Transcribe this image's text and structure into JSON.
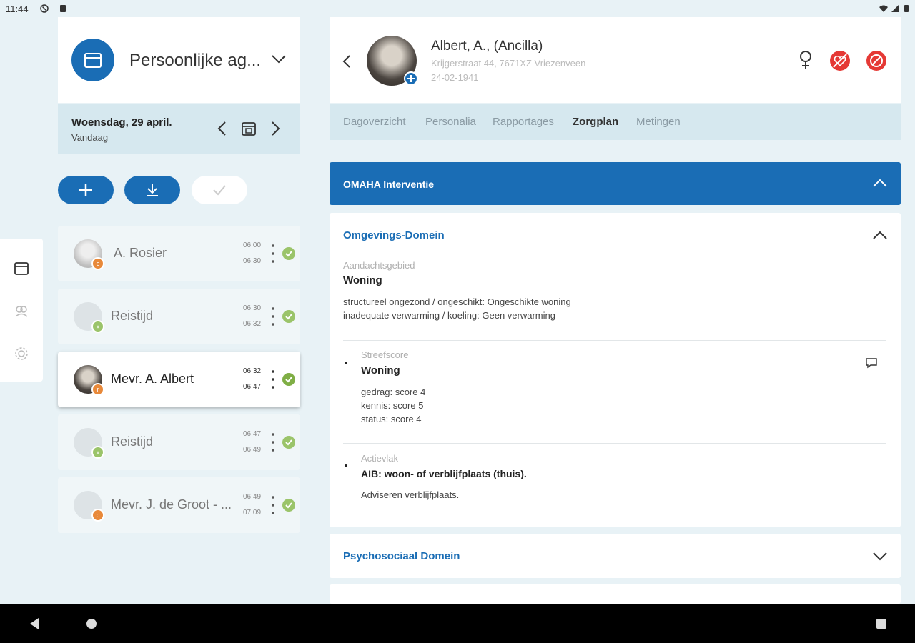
{
  "status": {
    "time": "11:44"
  },
  "agenda": {
    "title": "Persoonlijke ag...",
    "date": "Woensdag, 29 april.",
    "date_sub": "Vandaag"
  },
  "appointments": [
    {
      "name": "A. Rosier",
      "start": "06.00",
      "end": "06.30",
      "badge": "c"
    },
    {
      "name": "Reistijd",
      "start": "06.30",
      "end": "06.32",
      "badge": "x"
    },
    {
      "name": "Mevr. A. Albert",
      "start": "06.32",
      "end": "06.47",
      "badge": "r"
    },
    {
      "name": "Reistijd",
      "start": "06.47",
      "end": "06.49",
      "badge": "x"
    },
    {
      "name": "Mevr. J. de Groot - ...",
      "start": "06.49",
      "end": "07.09",
      "badge": "c"
    }
  ],
  "patient": {
    "name": "Albert, A., (Ancilla)",
    "address": "Krijgerstraat 44, 7671XZ Vriezenveen",
    "dob": "24-02-1941"
  },
  "tabs": [
    "Dagoverzicht",
    "Personalia",
    "Rapportages",
    "Zorgplan",
    "Metingen"
  ],
  "omaha": {
    "title": "OMAHA Interventie"
  },
  "domain1": {
    "title": "Omgevings-Domein",
    "aandacht_label": "Aandachtsgebied",
    "aandacht_value": "Woning",
    "line1": "structureel ongezond / ongeschikt:  Ongeschikte woning",
    "line2": "inadequate verwarming / koeling:  Geen verwarming",
    "streef_label": "Streefscore",
    "streef_value": "Woning",
    "score1": "gedrag: score 4",
    "score2": "kennis: score 5",
    "score3": "status: score 4",
    "actie_label": "Actievlak",
    "actie_value": "AIB:  woon- of verblijfplaats (thuis).",
    "actie_desc": "Adviseren verblijfplaats."
  },
  "domain2": {
    "title": "Psychosociaal Domein"
  },
  "colors": {
    "primary": "#1a6db5",
    "check": "#9bc46a",
    "badge_orange": "#e8893a",
    "badge_green": "#9bc46a",
    "danger": "#e53935"
  }
}
